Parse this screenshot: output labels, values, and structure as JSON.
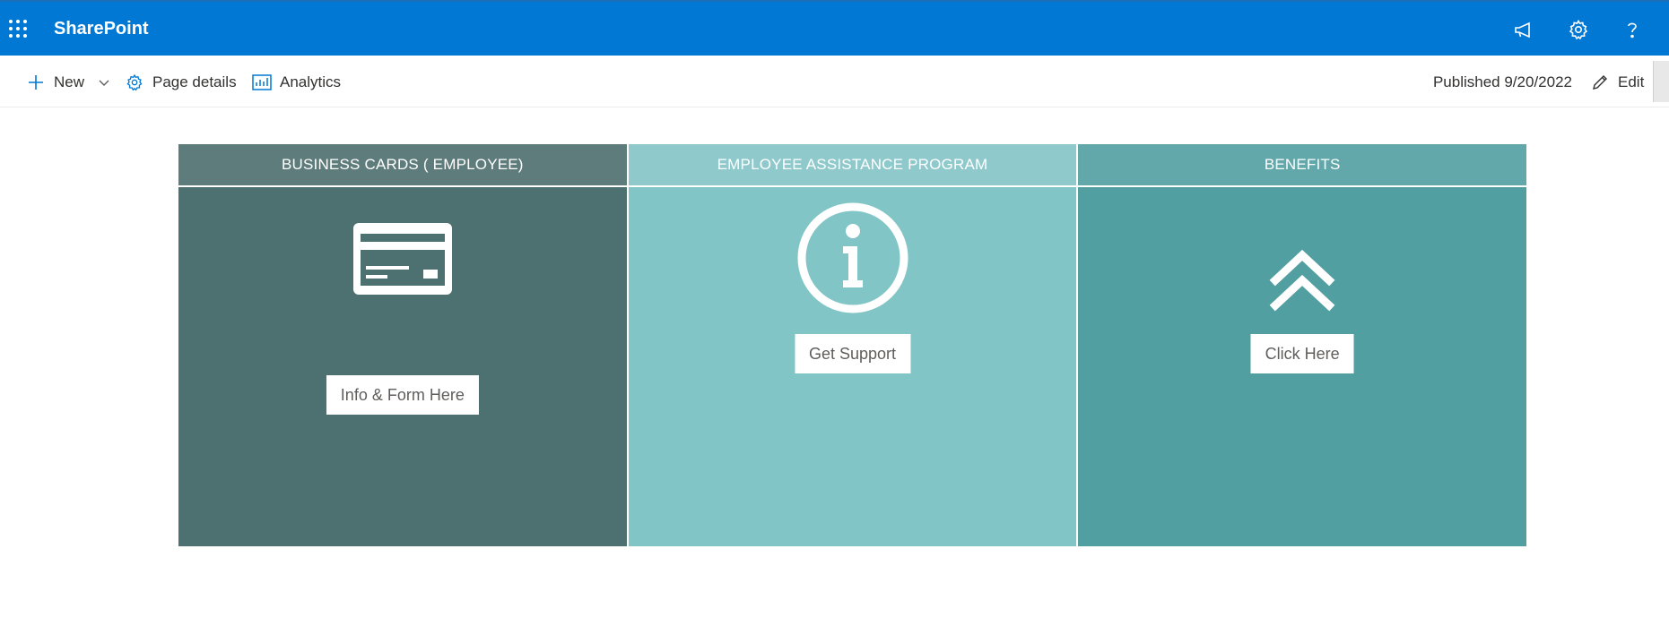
{
  "suite_bar": {
    "app_name": "SharePoint",
    "icons": [
      "waffle-icon",
      "megaphone-icon",
      "gear-icon",
      "help-icon"
    ],
    "background": "#0078d4"
  },
  "command_bar": {
    "new_label": "New",
    "page_details_label": "Page details",
    "analytics_label": "Analytics",
    "published_label": "Published 9/20/2022",
    "edit_label": "Edit"
  },
  "tiles": [
    {
      "header": "BUSINESS CARDS ( EMPLOYEE)",
      "icon": "credit-card-icon",
      "button_label": "Info & Form Here",
      "header_color": "#5f7c7c",
      "body_color": "#4d7070"
    },
    {
      "header": "EMPLOYEE ASSISTANCE PROGRAM",
      "icon": "info-icon",
      "button_label": "Get Support",
      "header_color": "#8fc9cc",
      "body_color": "#81c5c7"
    },
    {
      "header": "BENEFITS",
      "icon": "double-chevron-up-icon",
      "button_label": "Click Here",
      "header_color": "#62a8aa",
      "body_color": "#529fa1"
    }
  ]
}
